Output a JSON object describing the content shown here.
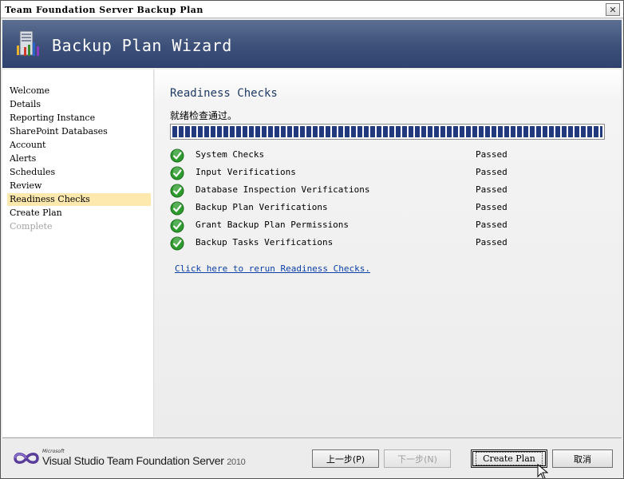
{
  "window": {
    "title": "Team Foundation Server Backup Plan",
    "close_glyph": "✕"
  },
  "banner": {
    "title": "Backup Plan Wizard"
  },
  "sidebar": {
    "items": [
      {
        "label": "Welcome",
        "state": "normal"
      },
      {
        "label": "Details",
        "state": "normal"
      },
      {
        "label": "Reporting Instance",
        "state": "normal"
      },
      {
        "label": "SharePoint Databases",
        "state": "normal"
      },
      {
        "label": "Account",
        "state": "normal"
      },
      {
        "label": "Alerts",
        "state": "normal"
      },
      {
        "label": "Schedules",
        "state": "normal"
      },
      {
        "label": "Review",
        "state": "normal"
      },
      {
        "label": "Readiness Checks",
        "state": "selected"
      },
      {
        "label": "Create Plan",
        "state": "normal"
      },
      {
        "label": "Complete",
        "state": "disabled"
      }
    ]
  },
  "main": {
    "title": "Readiness Checks",
    "status_message": "就绪检查通过。",
    "progress_fraction": 1.0,
    "checks": [
      {
        "label": "System Checks",
        "status": "Passed"
      },
      {
        "label": "Input Verifications",
        "status": "Passed"
      },
      {
        "label": "Database Inspection Verifications",
        "status": "Passed"
      },
      {
        "label": "Backup Plan Verifications",
        "status": "Passed"
      },
      {
        "label": "Grant Backup Plan Permissions",
        "status": "Passed"
      },
      {
        "label": "Backup Tasks Verifications",
        "status": "Passed"
      }
    ],
    "rerun_link": "Click here to rerun Readiness Checks."
  },
  "footer": {
    "brand_microsoft": "Microsoft",
    "brand_name": "Visual Studio Team Foundation Server",
    "brand_year": "2010",
    "buttons": {
      "back": "上一步(P)",
      "next": "下一步(N)",
      "create": "Create Plan",
      "cancel": "取消"
    }
  },
  "colors": {
    "banner": "#3c5079",
    "selected_nav": "#fde9ad",
    "progress": "#213a7d",
    "check_green": "#2e9b2e",
    "link": "#0b3fa8"
  },
  "icons": {
    "banner": "server-icon",
    "check": "check-icon",
    "logo": "visual-studio-logo-icon",
    "cursor": "mouse-pointer-icon"
  }
}
